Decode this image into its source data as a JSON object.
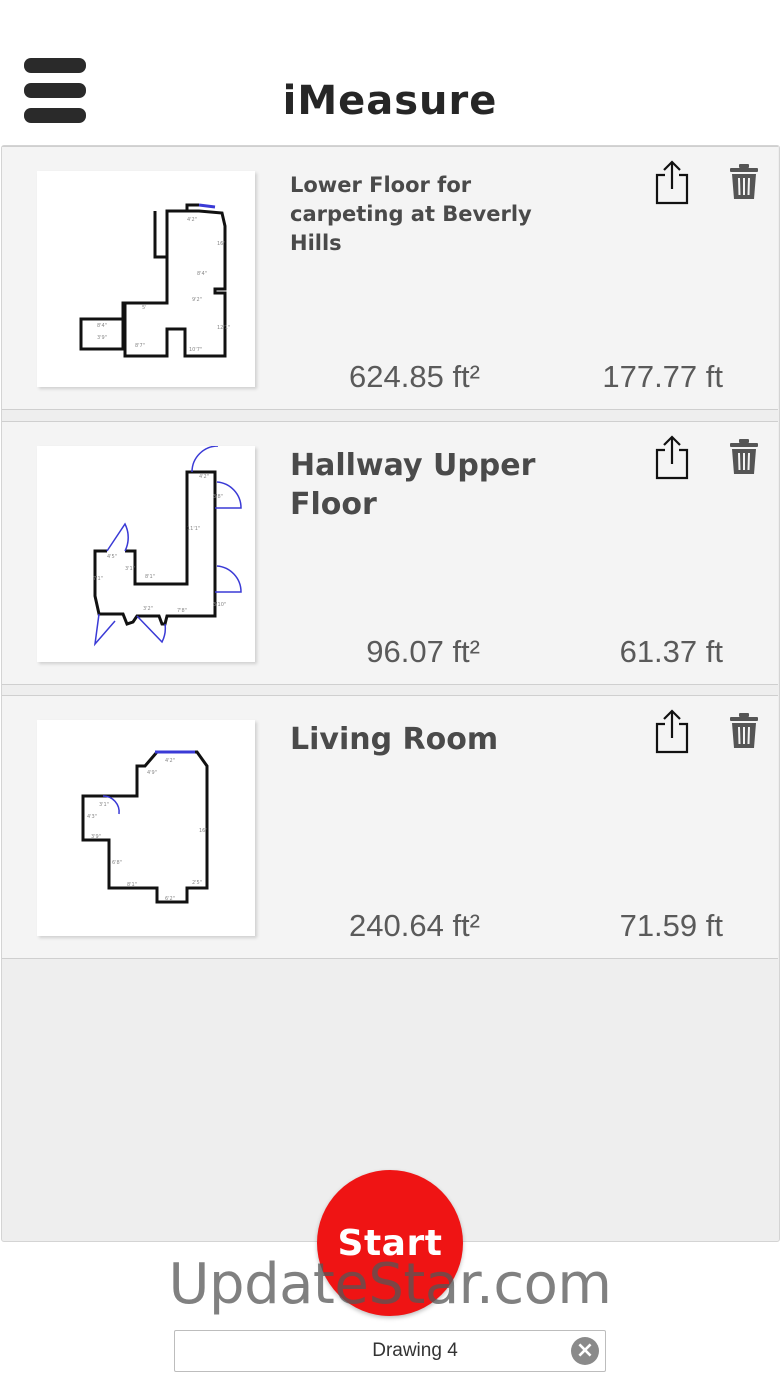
{
  "app": {
    "title": "iMeasure"
  },
  "drawings": [
    {
      "title": "Lower Floor for carpeting at Beverly Hills",
      "area": "624.85 ft²",
      "perimeter": "177.77 ft"
    },
    {
      "title": "Hallway Upper Floor",
      "area": "96.07 ft²",
      "perimeter": "61.37 ft"
    },
    {
      "title": "Living Room",
      "area": "240.64 ft²",
      "perimeter": "71.59 ft"
    }
  ],
  "start_button": {
    "label": "Start"
  },
  "watermark": "UpdateStar.com",
  "drawing_name": {
    "value": "Drawing 4"
  },
  "icons": {
    "menu": "hamburger-menu-icon",
    "share": "share-icon",
    "delete": "trash-icon",
    "clear": "clear-circle-x-icon"
  },
  "colors": {
    "start": "#ef1414",
    "door_arcs": "#3a3ad6",
    "walls": "#111111"
  }
}
